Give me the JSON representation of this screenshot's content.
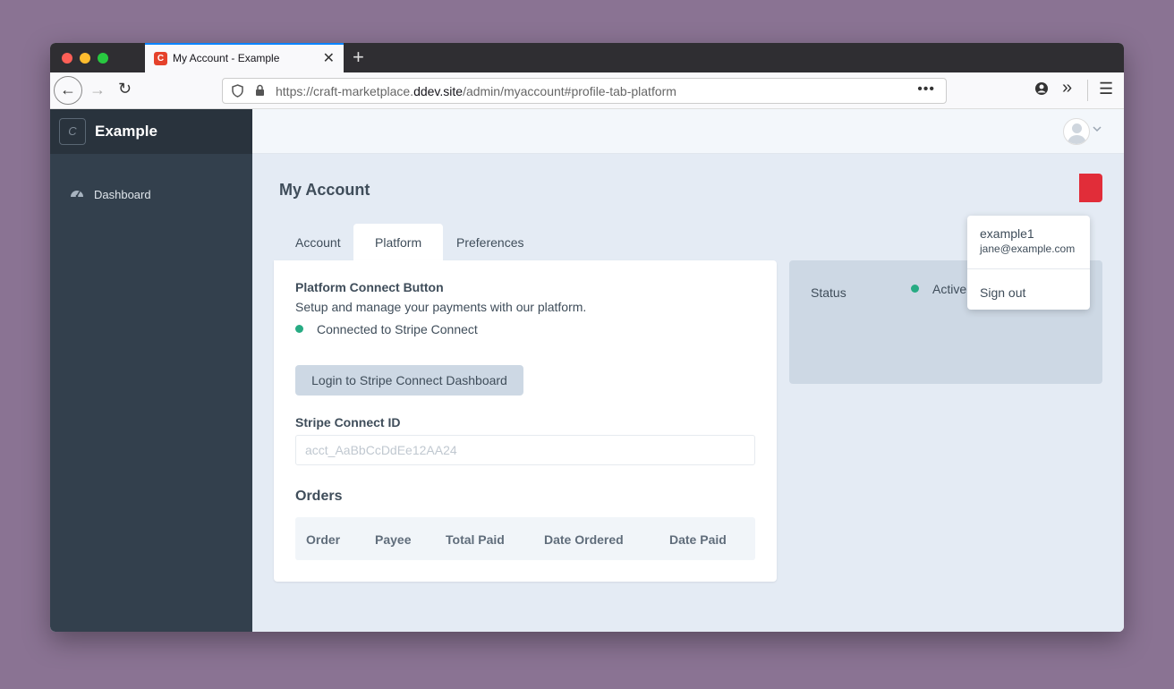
{
  "browser": {
    "tab_title": "My Account - Example",
    "tab_favicon": "C",
    "tab_close": "✕",
    "new_tab": "+",
    "url_prefix": "https://craft-marketplace.",
    "url_domain": "ddev.site",
    "url_path": "/admin/myaccount#profile-tab-platform",
    "url_more": "•••"
  },
  "sidebar": {
    "logo_letter": "C",
    "site_name": "Example",
    "items": [
      {
        "label": "Dashboard",
        "icon": "dashboard-gauge-icon"
      }
    ]
  },
  "page": {
    "title": "My Account",
    "tabs": [
      {
        "label": "Account"
      },
      {
        "label": "Platform"
      },
      {
        "label": "Preferences"
      }
    ]
  },
  "platform": {
    "heading": "Platform Connect Button",
    "description": "Setup and manage your payments with our platform.",
    "connected_text": "Connected to Stripe Connect",
    "dashboard_button": "Login to Stripe Connect Dashboard",
    "stripe_id_label": "Stripe Connect ID",
    "stripe_id_placeholder": "acct_AaBbCcDdEe12AA24",
    "orders_heading": "Orders",
    "orders_columns": [
      "Order",
      "Payee",
      "Total Paid",
      "Date Ordered",
      "Date Paid"
    ]
  },
  "status": {
    "label": "Status",
    "value": "Active"
  },
  "user_menu": {
    "username": "example1",
    "email": "jane@example.com",
    "sign_out": "Sign out"
  },
  "colors": {
    "sidebar": "#33404d",
    "accent_red": "#e12d39",
    "status_green": "#27ab83"
  }
}
